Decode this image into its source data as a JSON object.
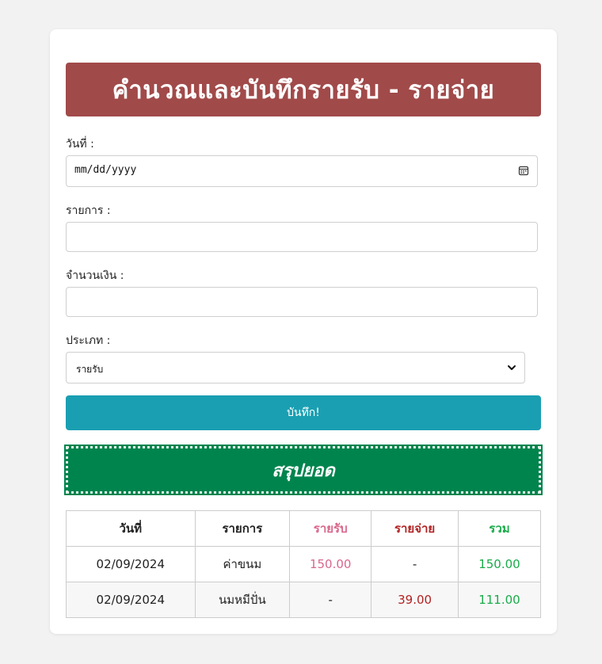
{
  "title": "คำนวณและบันทึกรายรับ - รายจ่าย",
  "form": {
    "date_label": "วันที่ :",
    "date_value": "mm/dd/yyyy",
    "item_label": "รายการ :",
    "item_value": "",
    "amount_label": "จำนวนเงิน :",
    "amount_value": "",
    "type_label": "ประเภท :",
    "type_selected": "รายรับ",
    "save_label": "บันทึก!"
  },
  "summary": {
    "label": "สรุปยอด"
  },
  "table": {
    "headers": {
      "date": "วันที่",
      "item": "รายการ",
      "income": "รายรับ",
      "expense": "รายจ่าย",
      "total": "รวม"
    },
    "rows": [
      {
        "date": "02/09/2024",
        "item": "ค่าขนม",
        "income": "150.00",
        "expense": "-",
        "total": "150.00"
      },
      {
        "date": "02/09/2024",
        "item": "นมหมีปั่น",
        "income": "-",
        "expense": "39.00",
        "total": "111.00"
      }
    ]
  },
  "colors": {
    "title_bg": "#a14a4a",
    "save_bg": "#1a9fb2",
    "summary_bg": "#00844e",
    "income": "#d9678c",
    "expense": "#b22222",
    "total": "#1aab4a"
  }
}
